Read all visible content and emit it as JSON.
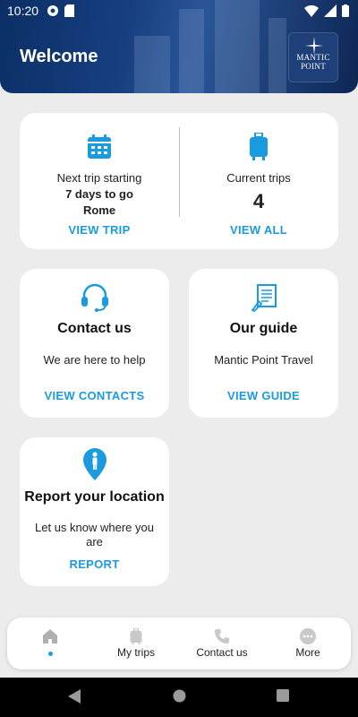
{
  "status_bar": {
    "time": "10:20"
  },
  "header": {
    "title": "Welcome",
    "logo_line1": "MANTIC",
    "logo_line2": "POINT"
  },
  "trip_card": {
    "next_label": "Next trip starting",
    "next_days": "7 days to go",
    "next_destination": "Rome",
    "view_trip": "VIEW TRIP",
    "current_label": "Current trips",
    "current_count": "4",
    "view_all": "VIEW ALL"
  },
  "contact_card": {
    "title": "Contact us",
    "subtitle": "We are here to help",
    "action": "VIEW CONTACTS"
  },
  "guide_card": {
    "title": "Our guide",
    "subtitle": "Mantic Point Travel",
    "action": "VIEW GUIDE"
  },
  "report_card": {
    "title": "Report your location",
    "subtitle_line1": "Let us know where you",
    "subtitle_line2": "are",
    "action": "REPORT"
  },
  "bottom_nav": {
    "items": [
      {
        "label": "",
        "icon": "home-icon",
        "active": true
      },
      {
        "label": "My trips",
        "icon": "luggage-icon"
      },
      {
        "label": "Contact us",
        "icon": "phone-icon"
      },
      {
        "label": "More",
        "icon": "more-icon"
      }
    ]
  },
  "colors": {
    "accent": "#1a9be0",
    "header": "#173f80",
    "background": "#ececec"
  }
}
